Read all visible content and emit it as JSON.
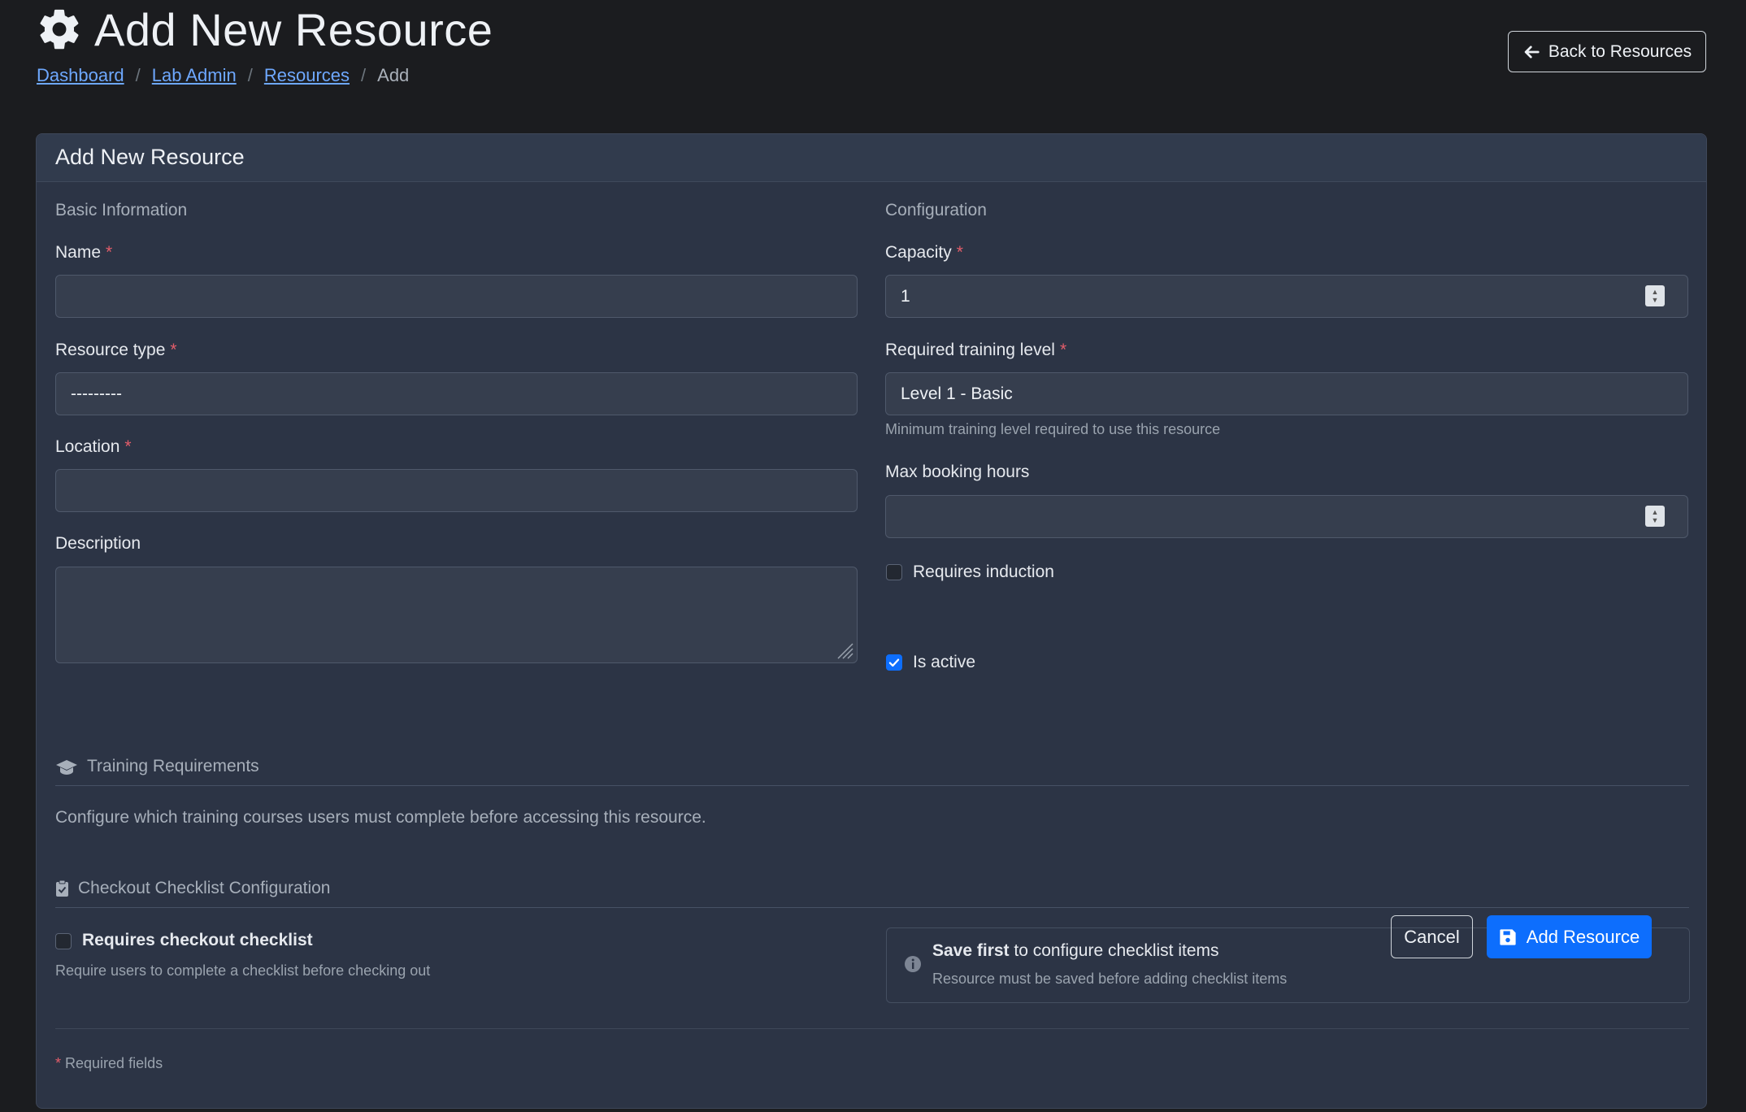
{
  "header": {
    "title": "Add New Resource",
    "breadcrumb": {
      "dashboard": "Dashboard",
      "lab_admin": "Lab Admin",
      "resources": "Resources",
      "current": "Add"
    },
    "back_label": "Back to Resources"
  },
  "card": {
    "title": "Add New Resource",
    "basic": {
      "heading": "Basic Information",
      "name_label": "Name",
      "name_value": "",
      "type_label": "Resource type",
      "type_value": "---------",
      "location_label": "Location",
      "location_value": "",
      "description_label": "Description",
      "description_value": ""
    },
    "config": {
      "heading": "Configuration",
      "capacity_label": "Capacity",
      "capacity_value": "1",
      "training_label": "Required training level",
      "training_value": "Level 1 - Basic",
      "training_help": "Minimum training level required to use this resource",
      "max_hours_label": "Max booking hours",
      "max_hours_value": "",
      "induction_label": "Requires induction",
      "induction_checked": false,
      "active_label": "Is active",
      "active_checked": true
    },
    "training": {
      "heading": "Training Requirements",
      "text": "Configure which training courses users must complete before accessing this resource."
    },
    "checklist": {
      "heading": "Checkout Checklist Configuration",
      "requires_label": "Requires checkout checklist",
      "requires_checked": false,
      "requires_help": "Require users to complete a checklist before checking out",
      "info_bold": "Save first",
      "info_rest": " to configure checklist items",
      "info_sub": "Resource must be saved before adding checklist items"
    },
    "footer": {
      "required_star": "*",
      "required_note": " Required fields",
      "cancel_label": "Cancel",
      "add_label": "Add Resource"
    }
  },
  "colors": {
    "accent": "#0d6efd",
    "required": "#e35d6a",
    "link": "#6ea8fe",
    "card_bg": "#2c3445",
    "page_bg": "#1b1c1f"
  }
}
